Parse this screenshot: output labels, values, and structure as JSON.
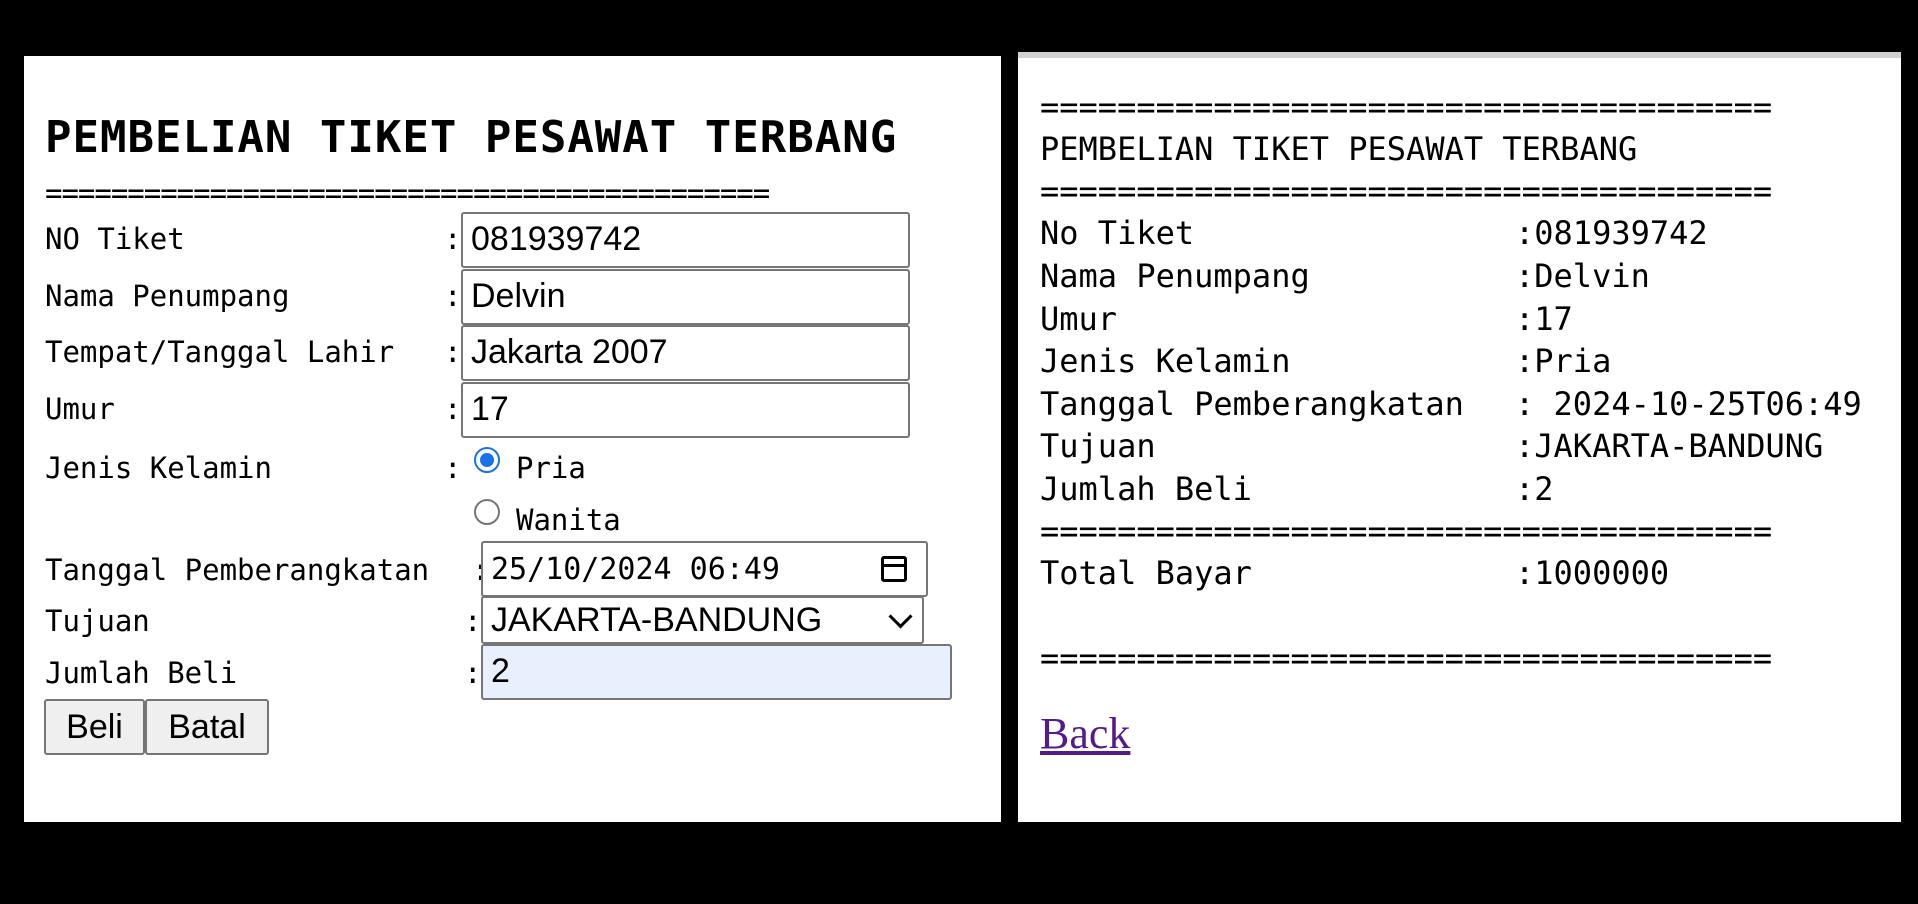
{
  "form": {
    "title": "PEMBELIAN TIKET PESAWAT TERBANG",
    "separator": "============================================",
    "fields": {
      "no_tiket": {
        "label": "NO Tiket",
        "value": "081939742"
      },
      "nama": {
        "label": "Nama Penumpang",
        "value": "Delvin"
      },
      "ttl": {
        "label": "Tempat/Tanggal Lahir",
        "value": "Jakarta 2007"
      },
      "umur": {
        "label": "Umur",
        "value": "17"
      },
      "jenis_kelamin": {
        "label": "Jenis Kelamin",
        "options": [
          "Pria",
          "Wanita"
        ],
        "selected": "Pria"
      },
      "tanggal": {
        "label": "Tanggal Pemberangkatan",
        "value": "25/10/2024 06:49"
      },
      "tujuan": {
        "label": "Tujuan",
        "value": "JAKARTA-BANDUNG"
      },
      "jumlah": {
        "label": "Jumlah Beli",
        "value": "2"
      }
    },
    "colon": ":",
    "buttons": {
      "beli": "Beli",
      "batal": "Batal"
    }
  },
  "receipt": {
    "separator": "======================================",
    "title": "PEMBELIAN TIKET PESAWAT TERBANG",
    "rows": [
      {
        "label": "No Tiket",
        "value": ":081939742"
      },
      {
        "label": "Nama Penumpang",
        "value": ":Delvin"
      },
      {
        "label": "Umur",
        "value": ":17"
      },
      {
        "label": "Jenis Kelamin",
        "value": ":Pria"
      },
      {
        "label": "Tanggal Pemberangkatan",
        "value": ": 2024-10-25T06:49"
      },
      {
        "label": "Tujuan",
        "value": ":JAKARTA-BANDUNG"
      },
      {
        "label": "Jumlah Beli",
        "value": ":2"
      }
    ],
    "total": {
      "label": "Total Bayar",
      "value": ":1000000"
    },
    "back_link": "Back"
  },
  "colors": {
    "page_bg": "#000000",
    "panel_bg": "#ffffff",
    "radio_accent": "#1a73e8",
    "autofill_bg": "#e8f0fe",
    "visited_link": "#551a8b"
  }
}
